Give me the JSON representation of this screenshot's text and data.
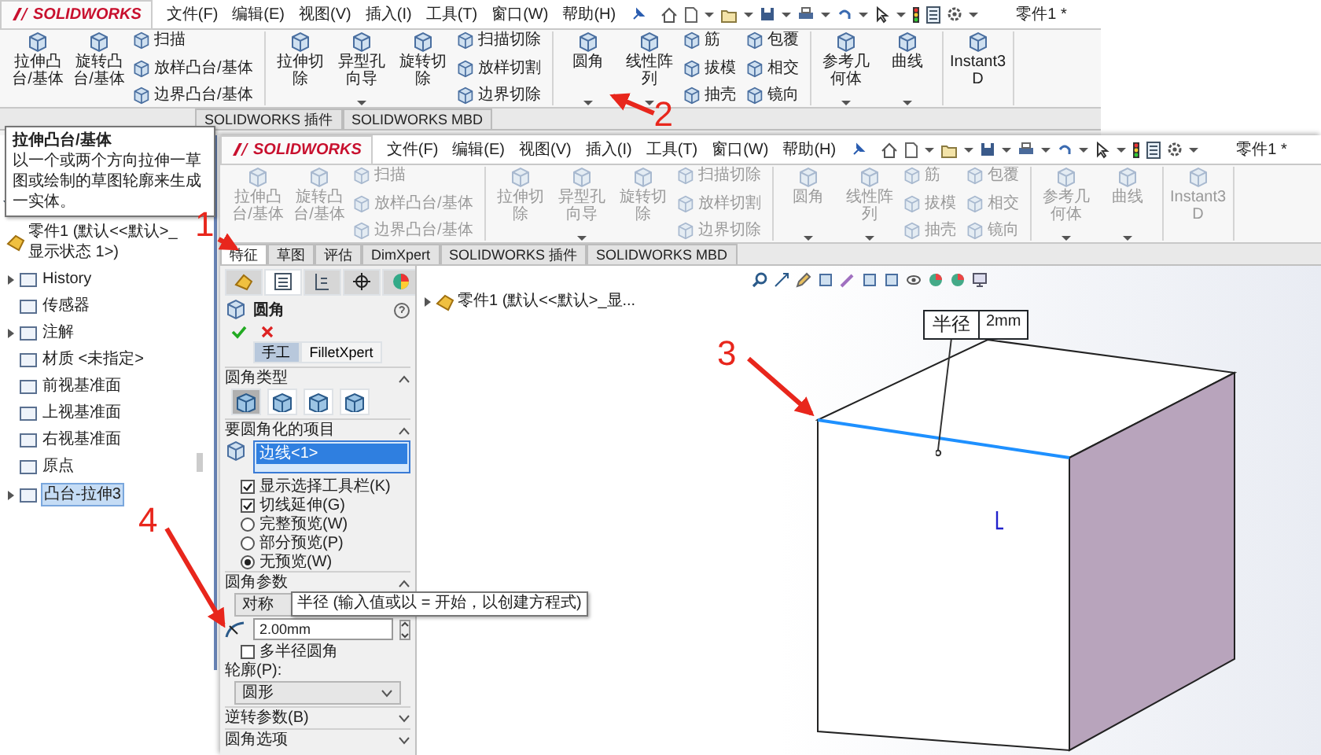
{
  "back_window": {
    "logo": "SOLIDWORKS",
    "menu": [
      "文件(F)",
      "编辑(E)",
      "视图(V)",
      "插入(I)",
      "工具(T)",
      "窗口(W)",
      "帮助(H)"
    ],
    "document_title": "零件1 *",
    "ribbon_disabled": false,
    "ribbon": [
      {
        "items": [
          {
            "kind": "large",
            "label": "拉伸凸台/基体",
            "menu": false
          },
          {
            "kind": "large",
            "label": "旋转凸台/基体",
            "menu": false
          },
          {
            "kind": "small",
            "label": "扫描"
          },
          {
            "kind": "small",
            "label": "放样凸台/基体"
          },
          {
            "kind": "small",
            "label": "边界凸台/基体"
          }
        ]
      },
      {
        "items": [
          {
            "kind": "large",
            "label": "拉伸切除",
            "menu": false
          },
          {
            "kind": "large",
            "label": "异型孔向导",
            "menu": true
          },
          {
            "kind": "large",
            "label": "旋转切除",
            "menu": false
          },
          {
            "kind": "small",
            "label": "扫描切除"
          },
          {
            "kind": "small",
            "label": "放样切割"
          },
          {
            "kind": "small",
            "label": "边界切除"
          }
        ]
      },
      {
        "items": [
          {
            "kind": "large",
            "label": "圆角",
            "menu": true
          },
          {
            "kind": "large",
            "label": "线性阵列",
            "menu": true
          },
          {
            "kind": "small",
            "label": "筋"
          },
          {
            "kind": "small",
            "label": "拔模"
          },
          {
            "kind": "small",
            "label": "抽壳"
          },
          {
            "kind": "small",
            "label": "包覆"
          },
          {
            "kind": "small",
            "label": "相交"
          },
          {
            "kind": "small",
            "label": "镜向"
          }
        ]
      },
      {
        "items": [
          {
            "kind": "large",
            "label": "参考几何体",
            "menu": true
          },
          {
            "kind": "large",
            "label": "曲线",
            "menu": true
          }
        ]
      },
      {
        "items": [
          {
            "kind": "large",
            "label": "Instant3D",
            "menu": false
          }
        ]
      }
    ],
    "tabs": [
      {
        "label": "SOLIDWORKS 插件",
        "selected": false
      },
      {
        "label": "SOLIDWORKS MBD",
        "selected": false
      }
    ],
    "tooltip": {
      "title": "拉伸凸台/基体",
      "text": "以一个或两个方向拉伸一草图或绘制的草图轮廓来生成一实体。"
    },
    "tree": {
      "root": "零件1 (默认<<默认>_显示状态 1>)",
      "items": [
        {
          "label": "History",
          "expandable": true,
          "selected": false
        },
        {
          "label": "传感器",
          "expandable": false,
          "selected": false
        },
        {
          "label": "注解",
          "expandable": true,
          "selected": false
        },
        {
          "label": "材质 <未指定>",
          "expandable": false,
          "selected": false
        },
        {
          "label": "前视基准面",
          "expandable": false,
          "selected": false
        },
        {
          "label": "上视基准面",
          "expandable": false,
          "selected": false
        },
        {
          "label": "右视基准面",
          "expandable": false,
          "selected": false
        },
        {
          "label": "原点",
          "expandable": false,
          "selected": false
        },
        {
          "label": "凸台-拉伸3",
          "expandable": true,
          "selected": true
        }
      ]
    }
  },
  "front_window": {
    "logo": "SOLIDWORKS",
    "menu": [
      "文件(F)",
      "编辑(E)",
      "视图(V)",
      "插入(I)",
      "工具(T)",
      "窗口(W)",
      "帮助(H)"
    ],
    "document_title": "零件1 *",
    "ribbon_disabled": true,
    "ribbon": [
      {
        "items": [
          {
            "kind": "large",
            "label": "拉伸凸台/基体",
            "menu": false
          },
          {
            "kind": "large",
            "label": "旋转凸台/基体",
            "menu": false
          },
          {
            "kind": "small",
            "label": "扫描"
          },
          {
            "kind": "small",
            "label": "放样凸台/基体"
          },
          {
            "kind": "small",
            "label": "边界凸台/基体"
          }
        ]
      },
      {
        "items": [
          {
            "kind": "large",
            "label": "拉伸切除",
            "menu": false
          },
          {
            "kind": "large",
            "label": "异型孔向导",
            "menu": true
          },
          {
            "kind": "large",
            "label": "旋转切除",
            "menu": false
          },
          {
            "kind": "small",
            "label": "扫描切除"
          },
          {
            "kind": "small",
            "label": "放样切割"
          },
          {
            "kind": "small",
            "label": "边界切除"
          }
        ]
      },
      {
        "items": [
          {
            "kind": "large",
            "label": "圆角",
            "menu": true
          },
          {
            "kind": "large",
            "label": "线性阵列",
            "menu": true
          },
          {
            "kind": "small",
            "label": "筋"
          },
          {
            "kind": "small",
            "label": "拔模"
          },
          {
            "kind": "small",
            "label": "抽壳"
          },
          {
            "kind": "small",
            "label": "包覆"
          },
          {
            "kind": "small",
            "label": "相交"
          },
          {
            "kind": "small",
            "label": "镜向"
          }
        ]
      },
      {
        "items": [
          {
            "kind": "large",
            "label": "参考几何体",
            "menu": true
          },
          {
            "kind": "large",
            "label": "曲线",
            "menu": true
          }
        ]
      },
      {
        "items": [
          {
            "kind": "large",
            "label": "Instant3D",
            "menu": false
          }
        ]
      }
    ],
    "tabs": [
      {
        "label": "特征",
        "selected": true
      },
      {
        "label": "草图",
        "selected": false
      },
      {
        "label": "评估",
        "selected": false
      },
      {
        "label": "DimXpert",
        "selected": false
      },
      {
        "label": "SOLIDWORKS 插件",
        "selected": false
      },
      {
        "label": "SOLIDWORKS MBD",
        "selected": false
      }
    ],
    "tree_root": "零件1 (默认<<默认>_显...",
    "property_manager": {
      "panel_tabs": [
        {
          "selected": false
        },
        {
          "selected": true
        },
        {
          "selected": false
        },
        {
          "selected": false
        },
        {
          "selected": false
        }
      ],
      "title": "圆角",
      "modes": [
        {
          "label": "手工",
          "selected": true
        },
        {
          "label": "FilletXpert",
          "selected": false
        }
      ],
      "sections": [
        {
          "kind": "fillet_type",
          "title": "圆角类型",
          "expanded": true,
          "options": [
            {
              "selected": true
            },
            {
              "selected": false
            },
            {
              "selected": false
            },
            {
              "selected": false
            }
          ]
        },
        {
          "kind": "items",
          "title": "要圆角化的项目",
          "expanded": true,
          "selection": [
            {
              "label": "边线<1>",
              "selected": true
            }
          ],
          "options": [
            {
              "kind": "checkbox",
              "label": "显示选择工具栏(K)",
              "checked": true
            },
            {
              "kind": "checkbox",
              "label": "切线延伸(G)",
              "checked": true
            },
            {
              "kind": "radio",
              "label": "完整预览(W)",
              "checked": false
            },
            {
              "kind": "radio",
              "label": "部分预览(P)",
              "checked": false
            },
            {
              "kind": "radio",
              "label": "无预览(W)",
              "checked": true
            }
          ]
        },
        {
          "kind": "parameters",
          "title": "圆角参数",
          "expanded": true,
          "method": "对称",
          "tooltip": "半径 (输入值或以 = 开始，以创建方程式)",
          "radius": "2.00mm",
          "multi_radius": {
            "label": "多半径圆角",
            "checked": false
          },
          "profile_label": "轮廓(P):",
          "profile": "圆形"
        },
        {
          "kind": "collapsed",
          "title": "逆转参数(B)",
          "expanded": false
        },
        {
          "kind": "collapsed",
          "title": "圆角选项",
          "expanded": false
        }
      ]
    },
    "callout": {
      "label": "半径",
      "value": "2mm"
    }
  },
  "annotations": [
    "1",
    "2",
    "3",
    "4"
  ]
}
